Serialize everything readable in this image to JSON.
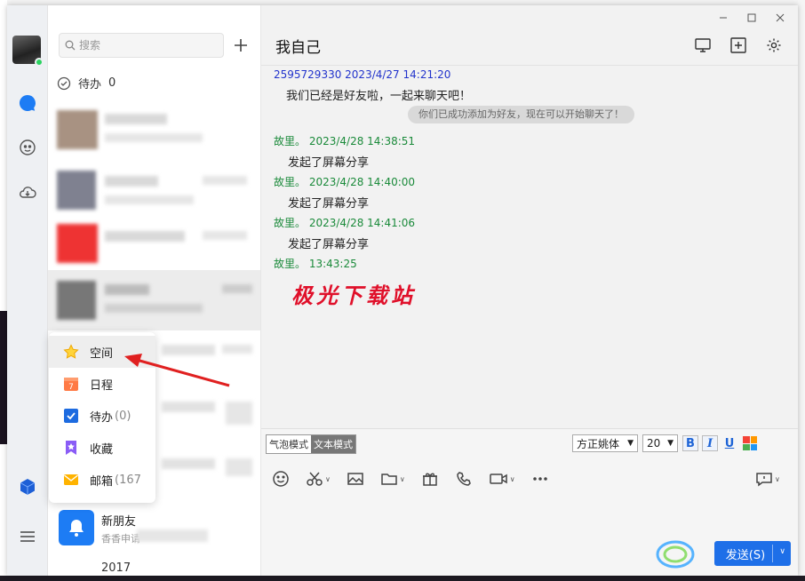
{
  "search": {
    "placeholder": "搜索"
  },
  "list": {
    "todo_label": "待办",
    "todo_count": "0",
    "friend_title": "新朋友",
    "friend_sub": "香香申请",
    "year_label": "2017"
  },
  "popup": {
    "items": [
      {
        "label": "空间",
        "count": ""
      },
      {
        "label": "日程",
        "count": ""
      },
      {
        "label": "待办",
        "count": "(0)"
      },
      {
        "label": "收藏",
        "count": ""
      },
      {
        "label": "邮箱",
        "count": "(167"
      }
    ]
  },
  "chat": {
    "title": "我自己",
    "messages": [
      {
        "meta": "2595729330  2023/4/27 14:21:20",
        "text": "我们已经是好友啦，一起来聊天吧！"
      },
      {
        "meta": "故里。 2023/4/28 14:38:51",
        "text": "发起了屏幕分享"
      },
      {
        "meta": "故里。 2023/4/28 14:40:00",
        "text": "发起了屏幕分享"
      },
      {
        "meta": "故里。 2023/4/28 14:41:06",
        "text": "发起了屏幕分享"
      },
      {
        "meta": "故里。 13:43:25",
        "text": ""
      }
    ],
    "system_tip": "你们已成功添加为好友，现在可以开始聊天了！",
    "watermark": "极光下载站"
  },
  "composer": {
    "bubble_mode": "气泡模式",
    "text_mode": "文本模式",
    "font": "方正姚体",
    "size": "20",
    "bold": "B",
    "italic": "I",
    "underline": "U",
    "send_label": "发送(S)"
  },
  "colors": {
    "accent": "#1e6fe8",
    "meta_blue": "#2233cc",
    "meta_green": "#1a8a3a",
    "watermark_red": "#e0102a"
  }
}
